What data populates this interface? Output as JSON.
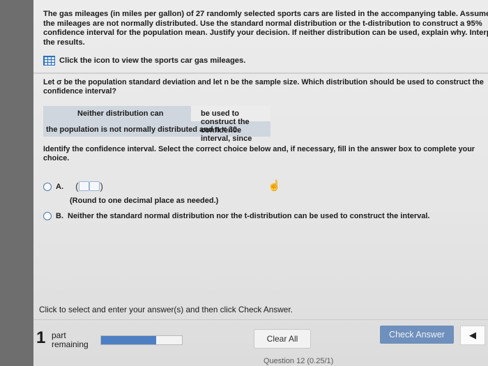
{
  "problem": {
    "lines": [
      "The gas mileages (in miles per gallon) of 27 randomly selected sports cars are listed in the accompanying table. Assume",
      "the mileages are not normally distributed. Use the standard normal distribution or the t-distribution to construct a 95%",
      "confidence interval for the population mean. Justify your decision. If neither distribution can be used, explain why. Interpret",
      "the results."
    ],
    "data_link": "Click the icon to view the sports car gas mileages."
  },
  "question1": {
    "lines": [
      "Let σ be the population standard deviation and let n be the sample size. Which distribution should be used to construct the",
      "confidence interval?"
    ],
    "answer_part1": "Neither distribution can",
    "answer_part2": "be used to construct the confidence interval, since",
    "answer_line2": "the population is not normally distributed and n < 30."
  },
  "question2": {
    "lines": [
      "Identify the confidence interval. Select the correct choice below and, if necessary, fill in the answer box to complete your",
      "choice."
    ],
    "optionA_label": "A.",
    "optionA_note": "(Round to one decimal place as needed.)",
    "optionB_label": "B.",
    "optionB_text": "Neither the standard normal distribution nor the t-distribution can be used to construct the interval."
  },
  "footer": {
    "instruction": "Click to select and enter your answer(s) and then click Check Answer.",
    "parts_count": "1",
    "parts_text_1": "part",
    "parts_text_2": "remaining",
    "progress_fraction": 0.68,
    "clear_all": "Clear All",
    "check_answer": "Check Answer",
    "next_question": "Question 12 (0.25/1)"
  }
}
